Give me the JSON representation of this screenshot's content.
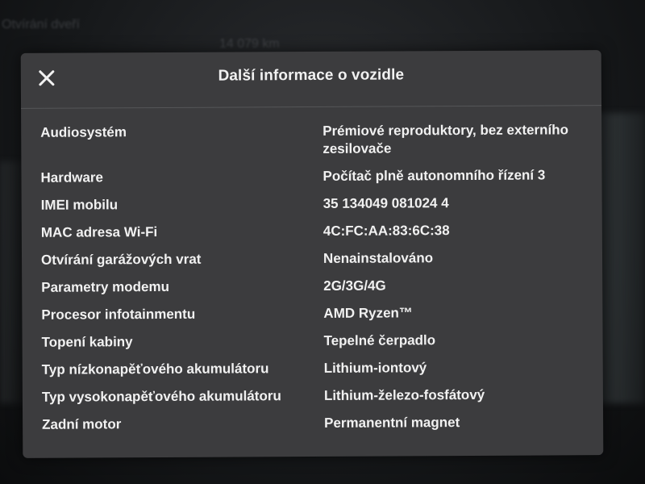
{
  "background": {
    "text_top": "Otvírání dveří",
    "text_odometer": "14 079 km"
  },
  "dialog": {
    "title": "Další informace o vozidle",
    "close_icon": "close-icon",
    "rows": [
      {
        "label": "Audiosystém",
        "value": "Prémiové reproduktory, bez externího zesilovače"
      },
      {
        "label": "Hardware",
        "value": "Počítač plně autonomního řízení 3"
      },
      {
        "label": "IMEI mobilu",
        "value": "35 134049 081024 4"
      },
      {
        "label": "MAC adresa Wi-Fi",
        "value": "4C:FC:AA:83:6C:38"
      },
      {
        "label": "Otvírání garážových vrat",
        "value": "Nenainstalováno"
      },
      {
        "label": "Parametry modemu",
        "value": "2G/3G/4G"
      },
      {
        "label": "Procesor infotainmentu",
        "value": "AMD Ryzen™"
      },
      {
        "label": "Topení kabiny",
        "value": "Tepelné čerpadlo"
      },
      {
        "label": "Typ nízkonapěťového akumulátoru",
        "value": "Lithium-iontový"
      },
      {
        "label": "Typ vysokonapěťového akumulátoru",
        "value": "Lithium-železo-fosfátový"
      },
      {
        "label": "Zadní motor",
        "value": "Permanentní magnet"
      }
    ]
  },
  "colors": {
    "dialog_bg": "#3c3c3e",
    "text": "#f1f1f1",
    "divider": "#555658"
  }
}
